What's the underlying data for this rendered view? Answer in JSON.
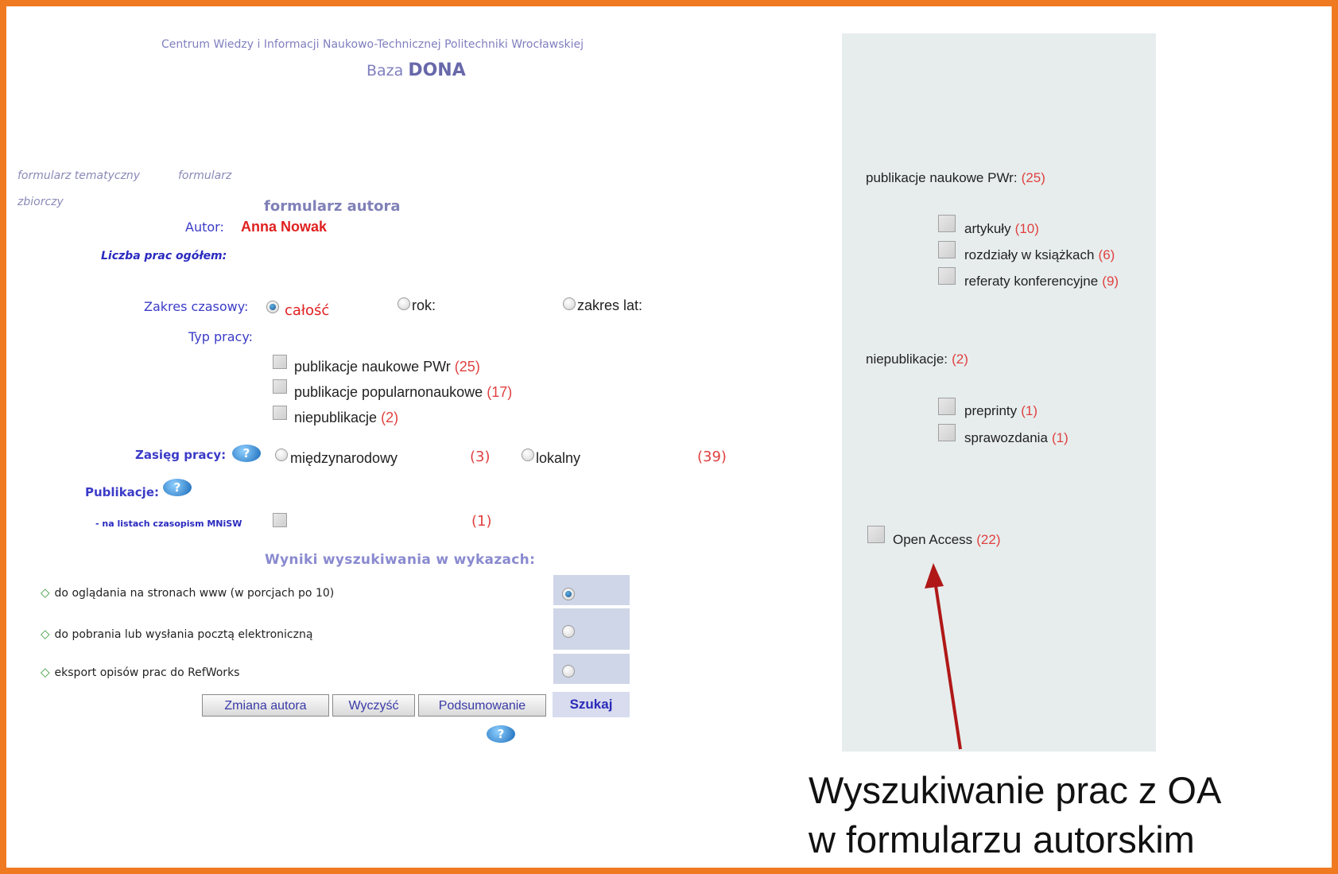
{
  "header": {
    "line1": "Centrum Wiedzy i Informacji Naukowo-Technicznej Politechniki Wrocławskiej",
    "baza_prefix": "Baza",
    "baza_name": "DONA"
  },
  "nav": {
    "formularz_tematyczny": "formularz tematyczny",
    "formularz_zbiorczy_1": "formularz",
    "formularz_zbiorczy_2": "zbiorczy",
    "formularz_autora": "formularz autora"
  },
  "author": {
    "label": "Autor:",
    "name": "Anna Nowak"
  },
  "liczba_prac": "Liczba prac ogółem:",
  "zakres": {
    "label": "Zakres czasowy:",
    "opt_calosc": "całość",
    "opt_rok": "rok:",
    "opt_zakres_lat": "zakres lat:"
  },
  "typ_pracy": {
    "label": "Typ pracy:",
    "items": [
      {
        "label": "publikacje naukowe PWr",
        "count": "(25)"
      },
      {
        "label": "publikacje popularnonaukowe",
        "count": "(17)"
      },
      {
        "label": "niepublikacje",
        "count": "(2)"
      }
    ]
  },
  "zasieg": {
    "label": "Zasięg pracy:",
    "opt_miedzynarodowy": "międzynarodowy",
    "count_miedzynarodowy": "(3)",
    "opt_lokalny": "lokalny",
    "count_lokalny": "(39)"
  },
  "publikacje": {
    "label": "Publikacje:",
    "mnisw_label": "- na listach czasopism MNiSW",
    "mnisw_count": "(1)"
  },
  "wyniki": {
    "title": "Wyniki wyszukiwania w wykazach:",
    "options": [
      {
        "label": "do oglądania na stronach www (w porcjach po 10)",
        "selected": true
      },
      {
        "label": "do pobrania  lub wysłania pocztą elektroniczną",
        "selected": false
      },
      {
        "label": "eksport opisów prac do RefWorks",
        "selected": false
      }
    ]
  },
  "buttons": {
    "zmiana_autora": "Zmiana autora",
    "wyczysc": "Wyczyść",
    "podsumowanie": "Podsumowanie",
    "szukaj": "Szukaj"
  },
  "help_icon": "question-mark-icon",
  "panel": {
    "naukowe_label": "publikacje naukowe PWr:",
    "naukowe_count": "(25)",
    "naukowe_items": [
      {
        "label": "artykuły",
        "count": "(10)"
      },
      {
        "label": "rozdziały w książkach",
        "count": "(6)"
      },
      {
        "label": "referaty konferencyjne",
        "count": "(9)"
      }
    ],
    "niepublikacje_label": "niepublikacje:",
    "niepublikacje_count": "(2)",
    "niepublikacje_items": [
      {
        "label": "preprinty",
        "count": "(1)"
      },
      {
        "label": "sprawozdania",
        "count": "(1)"
      }
    ],
    "open_access_label": "Open Access",
    "open_access_count": "(22)"
  },
  "caption": {
    "line1": "Wyszukiwanie prac z OA",
    "line2": "w formularzu autorskim"
  },
  "colors": {
    "frame": "#f07a21",
    "arrow": "#b01818",
    "panel_bg": "#e7eded",
    "count_red": "#e04040"
  }
}
